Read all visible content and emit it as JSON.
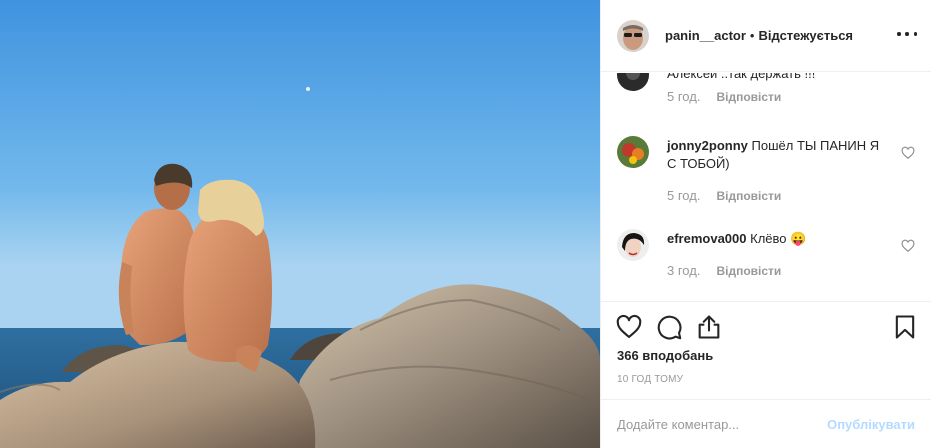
{
  "colors": {
    "accent": "#0095f6",
    "post_disabled": "#b3dbff",
    "muted": "#999999",
    "text": "#262626"
  },
  "header": {
    "username": "panin__actor",
    "separator": "•",
    "follow_label": "Відстежується",
    "more_icon": "more-horizontal-icon"
  },
  "comments": [
    {
      "username": "",
      "text": "Алексей ..так держать !!!",
      "time": "5 год.",
      "reply": "Відповісти",
      "has_heart": false
    },
    {
      "username": "jonny2ponny",
      "text": "Пошёл ТЫ ПАНИН Я С ТОБОЙ)",
      "time": "5 год.",
      "reply": "Відповісти",
      "has_heart": true
    },
    {
      "username": "efremova000",
      "text": "Клёво 😛",
      "time": "3 год.",
      "reply": "Відповісти",
      "has_heart": true
    }
  ],
  "actions": {
    "like_icon": "heart-icon",
    "comment_icon": "comment-icon",
    "share_icon": "share-icon",
    "save_icon": "bookmark-icon"
  },
  "likes": "366 вподобань",
  "posted": "10 ГОД ТОМУ",
  "add_comment": {
    "placeholder": "Додайте коментар...",
    "post_label": "Опублікувати"
  }
}
